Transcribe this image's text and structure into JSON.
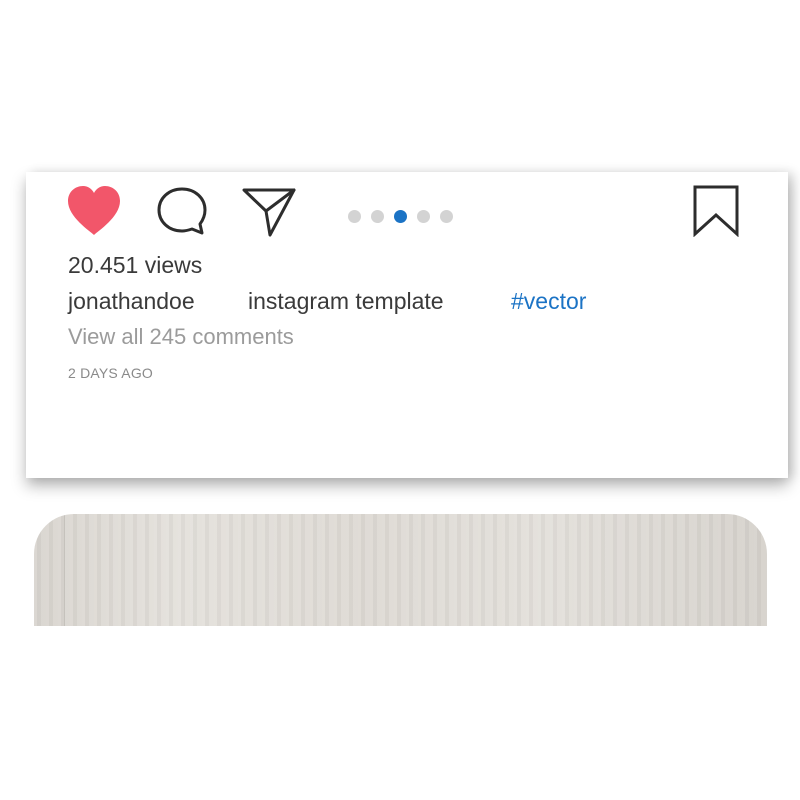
{
  "post": {
    "views": "20.451 views",
    "username": "jonathandoe",
    "caption": "instagram template",
    "hashtag": "#vector",
    "view_comments": "View all 245 comments",
    "timestamp": "2 DAYS AGO",
    "actions": {
      "like_icon": "heart-icon",
      "comment_icon": "speech-bubble-icon",
      "share_icon": "paper-plane-icon",
      "save_icon": "bookmark-icon"
    },
    "carousel": {
      "count": 5,
      "active_index": 2
    }
  },
  "colors": {
    "heart": "#f2566a",
    "icon_stroke": "#2d2d2d",
    "dot_inactive": "#d3d3d3",
    "dot_active": "#1b73c5",
    "hashtag": "#1b73c5"
  }
}
